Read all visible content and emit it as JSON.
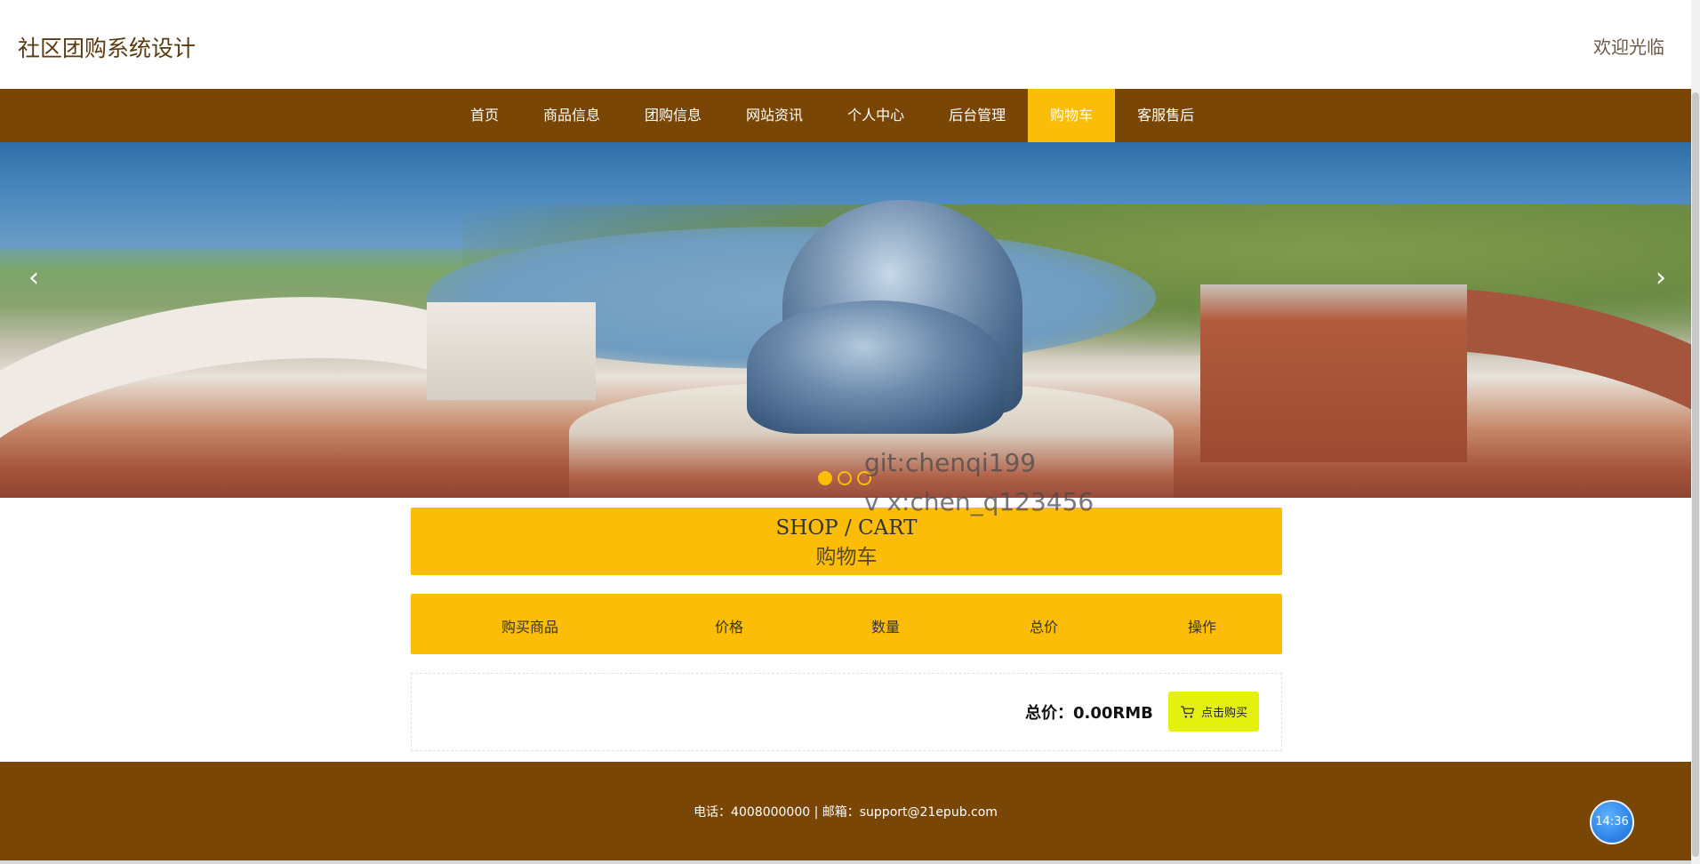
{
  "header": {
    "site_title": "社区团购系统设计",
    "welcome": "欢迎光临"
  },
  "nav": {
    "items": [
      {
        "label": "首页"
      },
      {
        "label": "商品信息"
      },
      {
        "label": "团购信息"
      },
      {
        "label": "网站资讯"
      },
      {
        "label": "个人中心"
      },
      {
        "label": "后台管理"
      },
      {
        "label": "购物车",
        "active": true
      },
      {
        "label": "客服售后"
      }
    ]
  },
  "banner": {
    "prev_icon": "‹",
    "next_icon": "›",
    "slide_count": 3,
    "active_slide": 1
  },
  "watermark": {
    "line1": "git:chenqi199",
    "line2": "v x:chen_q123456"
  },
  "cart": {
    "title_en": "SHOP / CART",
    "title_cn": "购物车",
    "columns": [
      "购买商品",
      "价格",
      "数量",
      "总价",
      "操作"
    ],
    "total": "总价：0.00RMB",
    "buy_label": "点击购买"
  },
  "footer": {
    "text": "电话：4008000000 | 邮箱：support@21epub.com"
  },
  "clock": {
    "time": "14:36"
  },
  "colors": {
    "brown": "#7a4606",
    "accent": "#fbbd08",
    "buy_button": "#e4f00d"
  },
  "icons": {
    "prev": "chevron-left-icon",
    "next": "chevron-right-icon",
    "cart": "cart-icon"
  }
}
